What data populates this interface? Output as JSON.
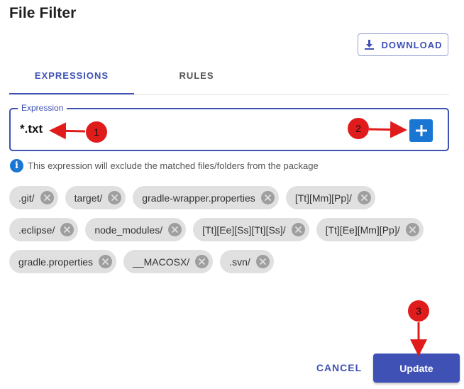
{
  "dialog": {
    "title": "File Filter"
  },
  "toolbar": {
    "download_label": "DOWNLOAD",
    "download_icon": "download-icon"
  },
  "tabs": [
    {
      "label": "EXPRESSIONS",
      "active": true
    },
    {
      "label": "RULES",
      "active": false
    }
  ],
  "expression": {
    "legend": "Expression",
    "value": "*.txt",
    "add_icon": "plus-icon"
  },
  "hint": {
    "icon": "info-icon",
    "glyph": "i",
    "text": "This expression will exclude the matched files/folders from the package"
  },
  "chip_rows": [
    [
      "git/",
      "target/",
      "gradle-wrapper.properties",
      "[Tt][Mm][Pp]/"
    ],
    [
      "eclipse/",
      "node_modules/",
      "[Tt][Ee][Ss][Tt][Ss]/",
      "[Tt][Ee][Mm][Pp]/"
    ],
    [
      "gradle.properties",
      "__MACOSX/",
      "svn/"
    ]
  ],
  "chips_prefix_dot": [
    [
      true,
      false,
      false,
      false
    ],
    [
      true,
      false,
      false,
      false
    ],
    [
      false,
      false,
      true
    ]
  ],
  "footer": {
    "cancel_label": "CANCEL",
    "update_label": "Update"
  },
  "annotations": {
    "markers": [
      "1",
      "2",
      "3"
    ]
  },
  "colors": {
    "accent": "#3f51b5",
    "add_button": "#1976d2",
    "annotation_red": "#e01b1b",
    "chip_bg": "#e0e0e0"
  }
}
